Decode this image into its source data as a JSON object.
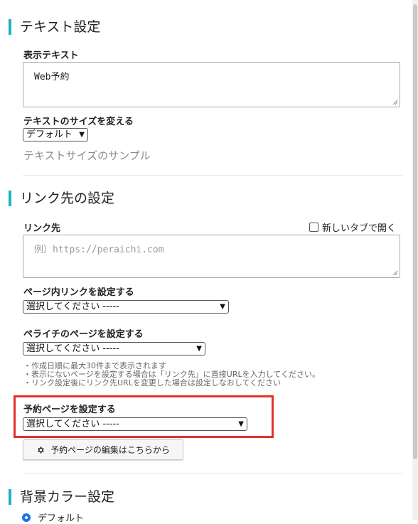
{
  "text_settings": {
    "title": "テキスト設定",
    "display_text_label": "表示テキスト",
    "display_text_value": "Web予約",
    "size_label": "テキストのサイズを変える",
    "size_selected": "デフォルト",
    "size_sample": "テキストサイズのサンプル"
  },
  "link_settings": {
    "title": "リンク先の設定",
    "link_label": "リンク先",
    "new_tab_label": "新しいタブで開く",
    "link_placeholder": "例）https://peraichi.com",
    "page_link_label": "ページ内リンクを設定する",
    "page_link_selected": "選択してください -----",
    "peraichi_page_label": "ペライチのページを設定する",
    "peraichi_page_selected": "選択してください -----",
    "notes": [
      "・作成日順に最大30件まで表示されます",
      "・表示にないページを設定する場合は「リンク先」に直接URLを入力してください。",
      "・リンク設定後にリンク先URLを変更した場合は設定しなおしてください"
    ],
    "reservation_label": "予約ページを設定する",
    "reservation_selected": "選択してください -----",
    "edit_reservation_button": "予約ページの編集はこちらから"
  },
  "background_settings": {
    "title": "背景カラー設定",
    "default_option": "デフォルト"
  },
  "colors": {
    "accent": "#19b3c8",
    "highlight": "#e0322d",
    "radio": "#1a73e8"
  }
}
